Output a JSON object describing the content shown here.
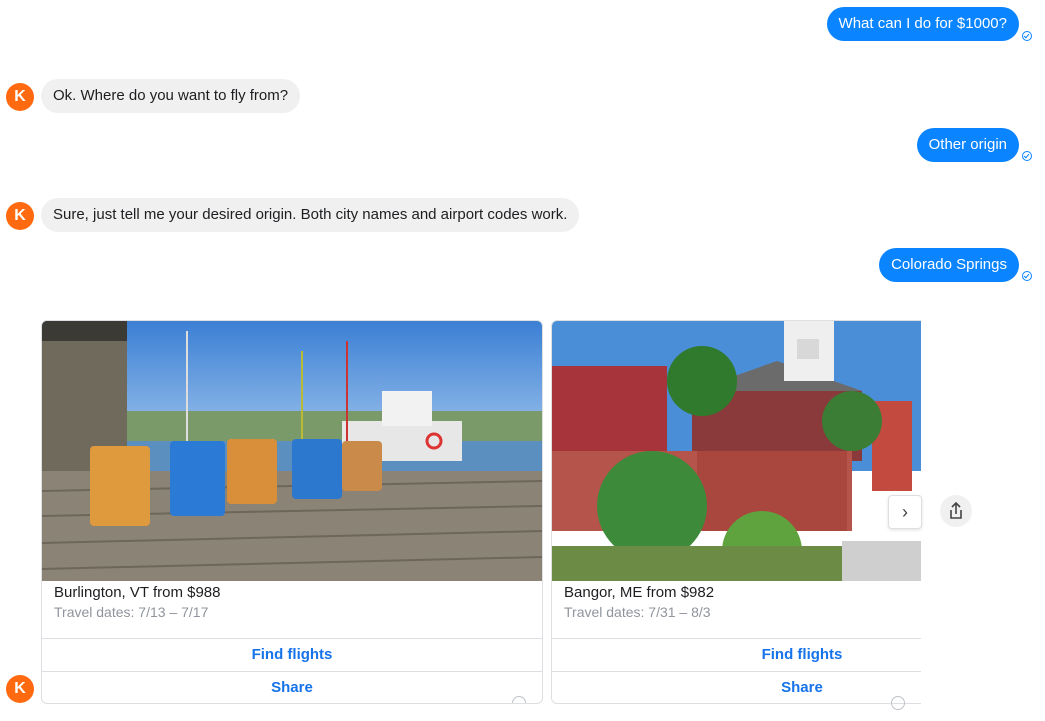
{
  "messages": {
    "m1_user": "What can I do for $1000?",
    "m2_bot": "Ok. Where do you want to fly from?",
    "m3_user": "Other origin",
    "m4_bot": "Sure, just tell me your desired origin. Both city names and airport codes work.",
    "m5_user": "Colorado Springs"
  },
  "avatar_letter": "K",
  "cards": [
    {
      "title": "Burlington, VT from $988",
      "dates": "Travel dates: 7/13 – 7/17",
      "button_find": "Find flights",
      "button_share": "Share"
    },
    {
      "title": "Bangor, ME from $982",
      "dates": "Travel dates: 7/31 – 8/3",
      "button_find": "Find flights",
      "button_share": "Share"
    }
  ],
  "carousel": {
    "next_glyph": "›"
  },
  "colors": {
    "user_bubble": "#0a84ff",
    "bot_bubble": "#f1f0f0",
    "avatar": "#ff690f",
    "link": "#1673ea"
  }
}
